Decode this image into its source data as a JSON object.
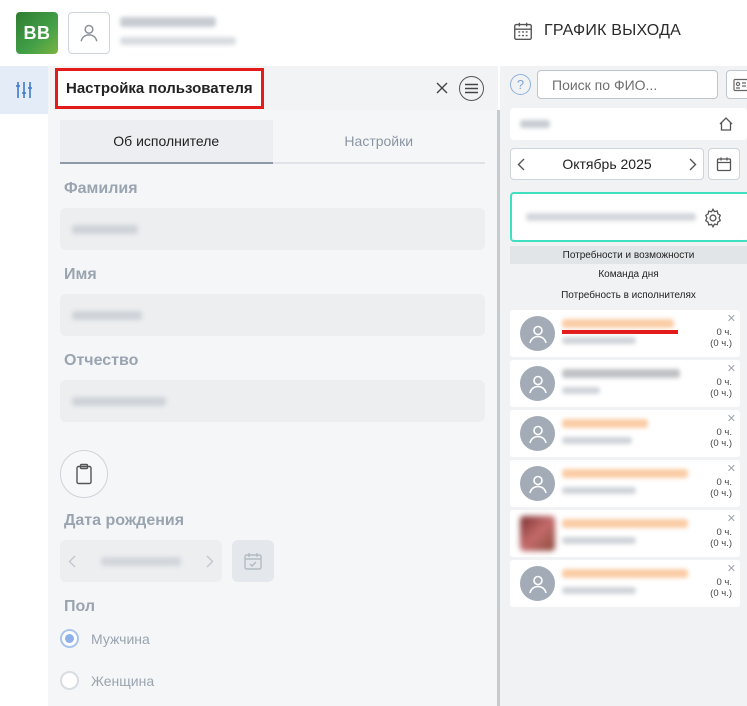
{
  "header": {
    "logo_text": "BB",
    "user_name": "",
    "user_role": "",
    "schedule_title": "ГРАФИК ВЫХОДА"
  },
  "colors": {
    "accent": "#3ee0c0",
    "highlight": "#e31b1b",
    "brand_green": "#43a047",
    "orange_name": "#f7a35c"
  },
  "panel": {
    "title": "Настройка пользователя",
    "tabs": [
      {
        "label": "Об исполнителе",
        "active": true
      },
      {
        "label": "Настройки",
        "active": false
      }
    ],
    "fields": [
      {
        "label": "Фамилия",
        "value": ""
      },
      {
        "label": "Имя",
        "value": ""
      },
      {
        "label": "Отчество",
        "value": ""
      }
    ],
    "birth_label": "Дата рождения",
    "birth_value": "",
    "gender_label": "Пол",
    "gender_options": [
      {
        "label": "Мужчина",
        "selected": true
      },
      {
        "label": "Женщина",
        "selected": false
      }
    ]
  },
  "right": {
    "search_placeholder": "Поиск по ФИО...",
    "department": "",
    "month_label": "Октябрь 2025",
    "team_name": "",
    "sections": [
      "Потребности и возможности",
      "Команда дня",
      "Потребность в исполнителях"
    ],
    "people": [
      {
        "name": "",
        "sub": "",
        "hours": "0 ч.",
        "hours_paren": "(0 ч.)",
        "name_color": "#f7a35c",
        "photo": false,
        "highlighted": true
      },
      {
        "name": "",
        "sub": "",
        "hours": "0 ч.",
        "hours_paren": "(0 ч.)",
        "name_color": "#8a8f96",
        "photo": false,
        "highlighted": false
      },
      {
        "name": "",
        "sub": "",
        "hours": "0 ч.",
        "hours_paren": "(0 ч.)",
        "name_color": "#f7a35c",
        "photo": false,
        "highlighted": false
      },
      {
        "name": "",
        "sub": "",
        "hours": "0 ч.",
        "hours_paren": "(0 ч.)",
        "name_color": "#f7a35c",
        "photo": false,
        "highlighted": false
      },
      {
        "name": "",
        "sub": "",
        "hours": "0 ч.",
        "hours_paren": "(0 ч.)",
        "name_color": "#f7a35c",
        "photo": true,
        "highlighted": false
      },
      {
        "name": "",
        "sub": "",
        "hours": "0 ч.",
        "hours_paren": "(0 ч.)",
        "name_color": "#f7a35c",
        "photo": false,
        "highlighted": false
      }
    ]
  }
}
